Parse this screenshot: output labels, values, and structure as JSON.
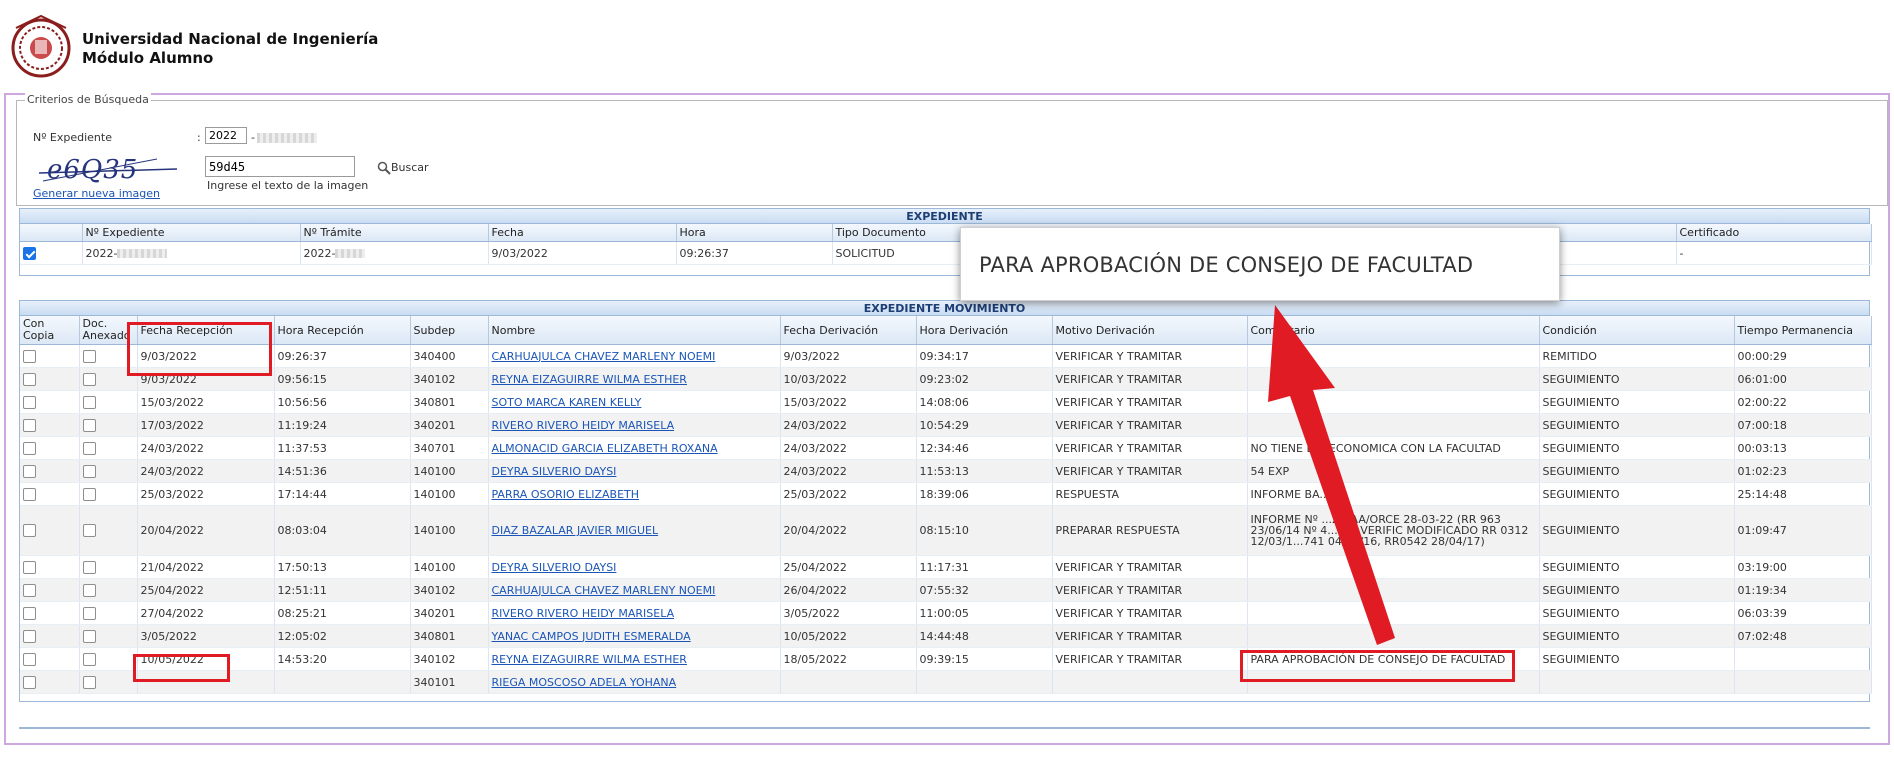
{
  "header": {
    "title": "Universidad Nacional de Ingeniería",
    "subtitle": "Módulo Alumno"
  },
  "criterios": {
    "legend": "Criterios de Búsqueda",
    "expediente_label": "Nº Expediente",
    "colon": ":",
    "year_value": "2022",
    "dash": "-",
    "captcha_input_value": "59d45",
    "captcha_hint": "Ingrese el texto de la imagen",
    "captcha_link": "Generar nueva imagen",
    "search_label": "Buscar"
  },
  "expediente": {
    "title": "EXPEDIENTE",
    "headers": [
      "Nº Expediente",
      "Nº Trámite",
      "Fecha",
      "Hora",
      "Tipo Documento",
      "Certificado"
    ],
    "row": {
      "expediente": "2022-",
      "tramite": "2022-",
      "fecha": "9/03/2022",
      "hora": "09:26:37",
      "tipo": "SOLICITUD",
      "certificado": "-"
    }
  },
  "movimiento": {
    "title": "EXPEDIENTE MOVIMIENTO",
    "headers": [
      "Con Copia",
      "Doc. Anexado",
      "Fecha Recepción",
      "Hora Recepción",
      "Subdep",
      "Nombre",
      "Fecha Derivación",
      "Hora Derivación",
      "Motivo Derivación",
      "Comentario",
      "Condición",
      "Tiempo Permanencia"
    ],
    "rows": [
      [
        "9/03/2022",
        "09:26:37",
        "340400",
        "CARHUAJULCA CHAVEZ MARLENY NOEMI",
        "9/03/2022",
        "09:34:17",
        "VERIFICAR Y TRAMITAR",
        "",
        "REMITIDO",
        "00:00:29"
      ],
      [
        "9/03/2022",
        "09:56:15",
        "340102",
        "REYNA EIZAGUIRRE WILMA ESTHER",
        "10/03/2022",
        "09:23:02",
        "VERIFICAR Y TRAMITAR",
        "",
        "SEGUIMIENTO",
        "06:01:00"
      ],
      [
        "15/03/2022",
        "10:56:56",
        "340801",
        "SOTO MARCA KAREN KELLY",
        "15/03/2022",
        "14:08:06",
        "VERIFICAR Y TRAMITAR",
        "",
        "SEGUIMIENTO",
        "02:00:22"
      ],
      [
        "17/03/2022",
        "11:19:24",
        "340201",
        "RIVERO RIVERO HEIDY MARISELA",
        "24/03/2022",
        "10:54:29",
        "VERIFICAR Y TRAMITAR",
        "",
        "SEGUIMIENTO",
        "07:00:18"
      ],
      [
        "24/03/2022",
        "11:37:53",
        "340701",
        "ALMONACID GARCIA ELIZABETH ROXANA",
        "24/03/2022",
        "12:34:46",
        "VERIFICAR Y TRAMITAR",
        "NO TIENE D... ECONOMICA CON LA FACULTAD",
        "SEGUIMIENTO",
        "00:03:13"
      ],
      [
        "24/03/2022",
        "14:51:36",
        "140100",
        "DEYRA SILVERIO DAYSI",
        "24/03/2022",
        "11:53:13",
        "VERIFICAR Y TRAMITAR",
        "54 EXP",
        "SEGUIMIENTO",
        "01:02:23"
      ],
      [
        "25/03/2022",
        "17:14:44",
        "140100",
        "PARRA OSORIO ELIZABETH",
        "25/03/2022",
        "18:39:06",
        "RESPUESTA",
        "INFORME BA...ER.",
        "SEGUIMIENTO",
        "25:14:48"
      ],
      [
        "20/04/2022",
        "08:03:04",
        "140100",
        "DIAZ BAZALAR JAVIER MIGUEL",
        "20/04/2022",
        "08:15:10",
        "PREPARAR RESPUESTA",
        "INFORME Nº ...2-AAA/ORCE 28-03-22 (RR 963 23/06/14 Nº 4... DE VERIFIC MODIFICADO RR 0312 12/03/1...741 04/11/16, RR0542 28/04/17)",
        "SEGUIMIENTO",
        "01:09:47"
      ],
      [
        "21/04/2022",
        "17:50:13",
        "140100",
        "DEYRA SILVERIO DAYSI",
        "25/04/2022",
        "11:17:31",
        "VERIFICAR Y TRAMITAR",
        "",
        "SEGUIMIENTO",
        "03:19:00"
      ],
      [
        "25/04/2022",
        "12:51:11",
        "340102",
        "CARHUAJULCA CHAVEZ MARLENY NOEMI",
        "26/04/2022",
        "07:55:32",
        "VERIFICAR Y TRAMITAR",
        "",
        "SEGUIMIENTO",
        "01:19:34"
      ],
      [
        "27/04/2022",
        "08:25:21",
        "340201",
        "RIVERO RIVERO HEIDY MARISELA",
        "3/05/2022",
        "11:00:05",
        "VERIFICAR Y TRAMITAR",
        "",
        "SEGUIMIENTO",
        "06:03:39"
      ],
      [
        "3/05/2022",
        "12:05:02",
        "340801",
        "YANAC CAMPOS JUDITH ESMERALDA",
        "10/05/2022",
        "14:44:48",
        "VERIFICAR Y TRAMITAR",
        "",
        "SEGUIMIENTO",
        "07:02:48"
      ],
      [
        "10/05/2022",
        "14:53:20",
        "340102",
        "REYNA EIZAGUIRRE WILMA ESTHER",
        "18/05/2022",
        "09:39:15",
        "VERIFICAR Y TRAMITAR",
        "PARA APROBACIÓN DE CONSEJO DE FACULTAD",
        "SEGUIMIENTO",
        ""
      ],
      [
        "",
        "",
        "340101",
        "RIEGA MOSCOSO ADELA YOHANA",
        "",
        "",
        "",
        "",
        "",
        ""
      ]
    ]
  },
  "callout": {
    "text": "PARA APROBACIÓN DE CONSEJO DE FACULTAD"
  },
  "colors": {
    "accent": "#1d3e75",
    "highlight": "#e01b24",
    "link": "#1a55b7"
  }
}
